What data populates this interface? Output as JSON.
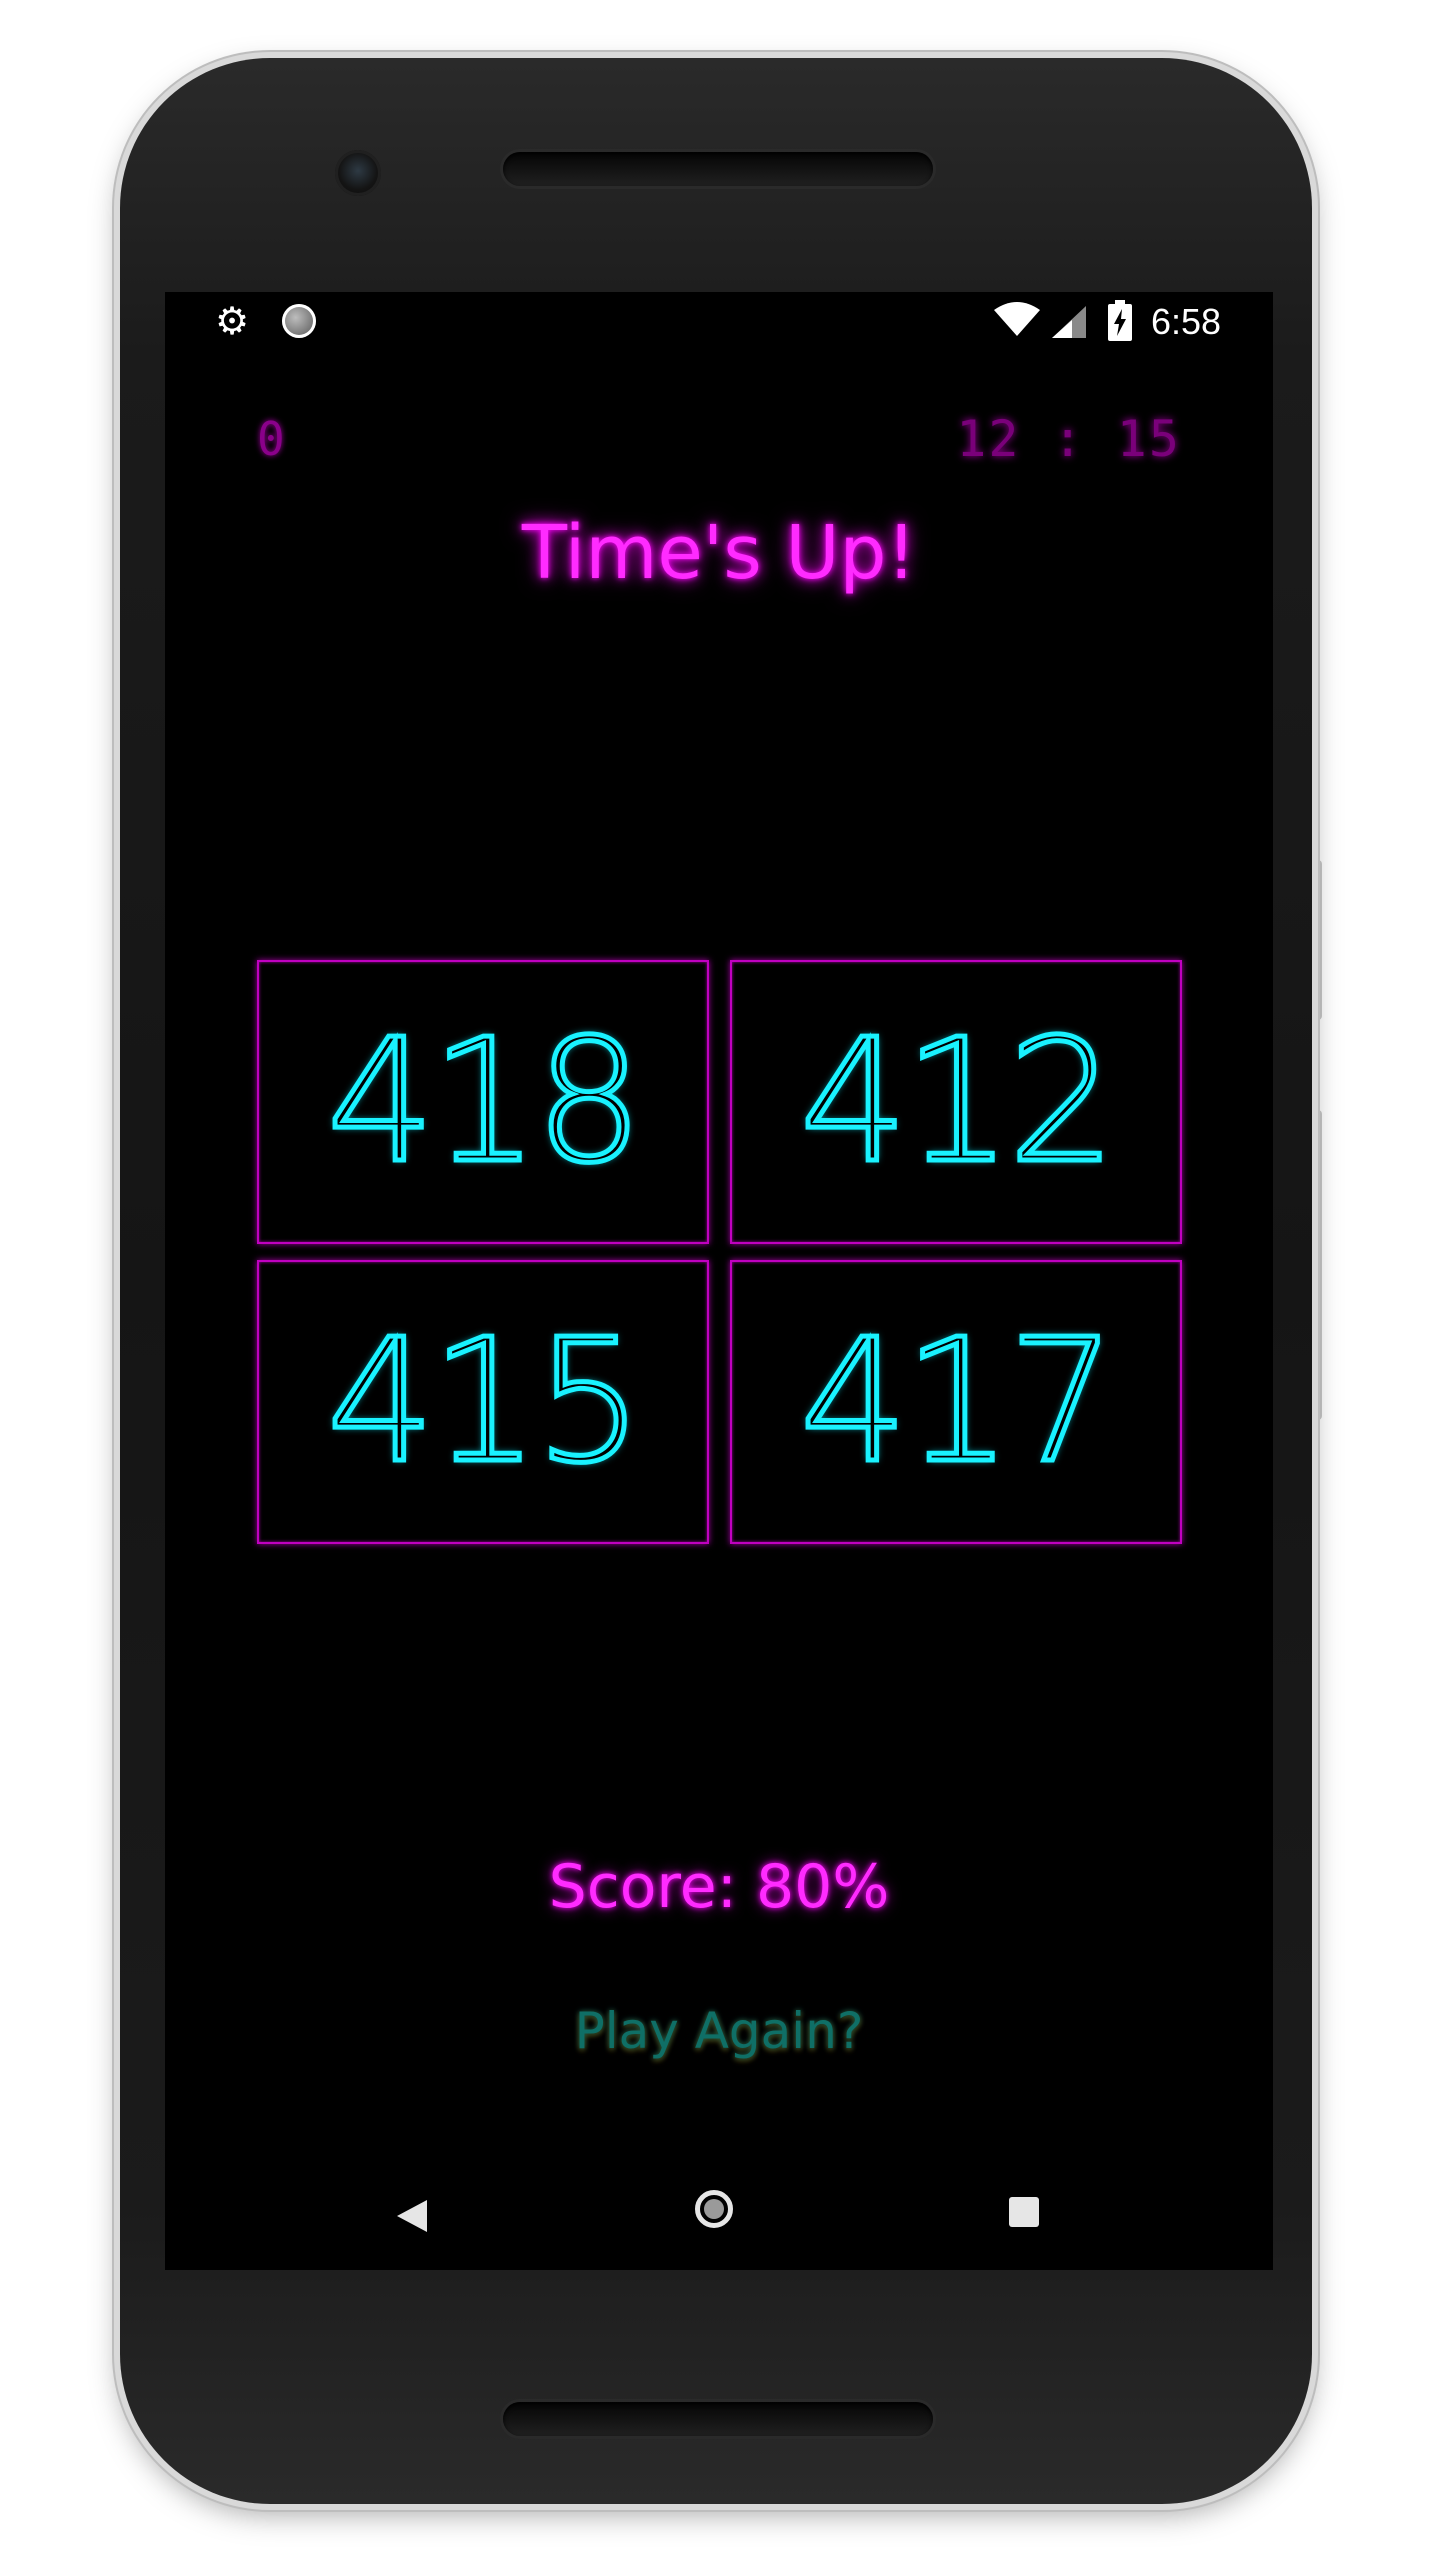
{
  "status_bar": {
    "time": "6:58",
    "icons": [
      "settings-gear-icon",
      "sync-indicator-icon",
      "wifi-icon",
      "cell-signal-icon",
      "battery-charging-icon"
    ]
  },
  "game": {
    "score": "0",
    "timer": "12 : 15",
    "title": "Time's Up!",
    "answers": [
      "418",
      "412",
      "415",
      "417"
    ],
    "final_score": "Score: 80%",
    "play_again": "Play Again?"
  },
  "nav_bar": {
    "icons": [
      "back-icon",
      "home-icon",
      "recents-icon"
    ]
  },
  "colors": {
    "background": "#000000",
    "accent_magenta": "#ff2bff",
    "answer_cyan": "#19f2ff",
    "play_again_teal": "#0f6f66"
  }
}
